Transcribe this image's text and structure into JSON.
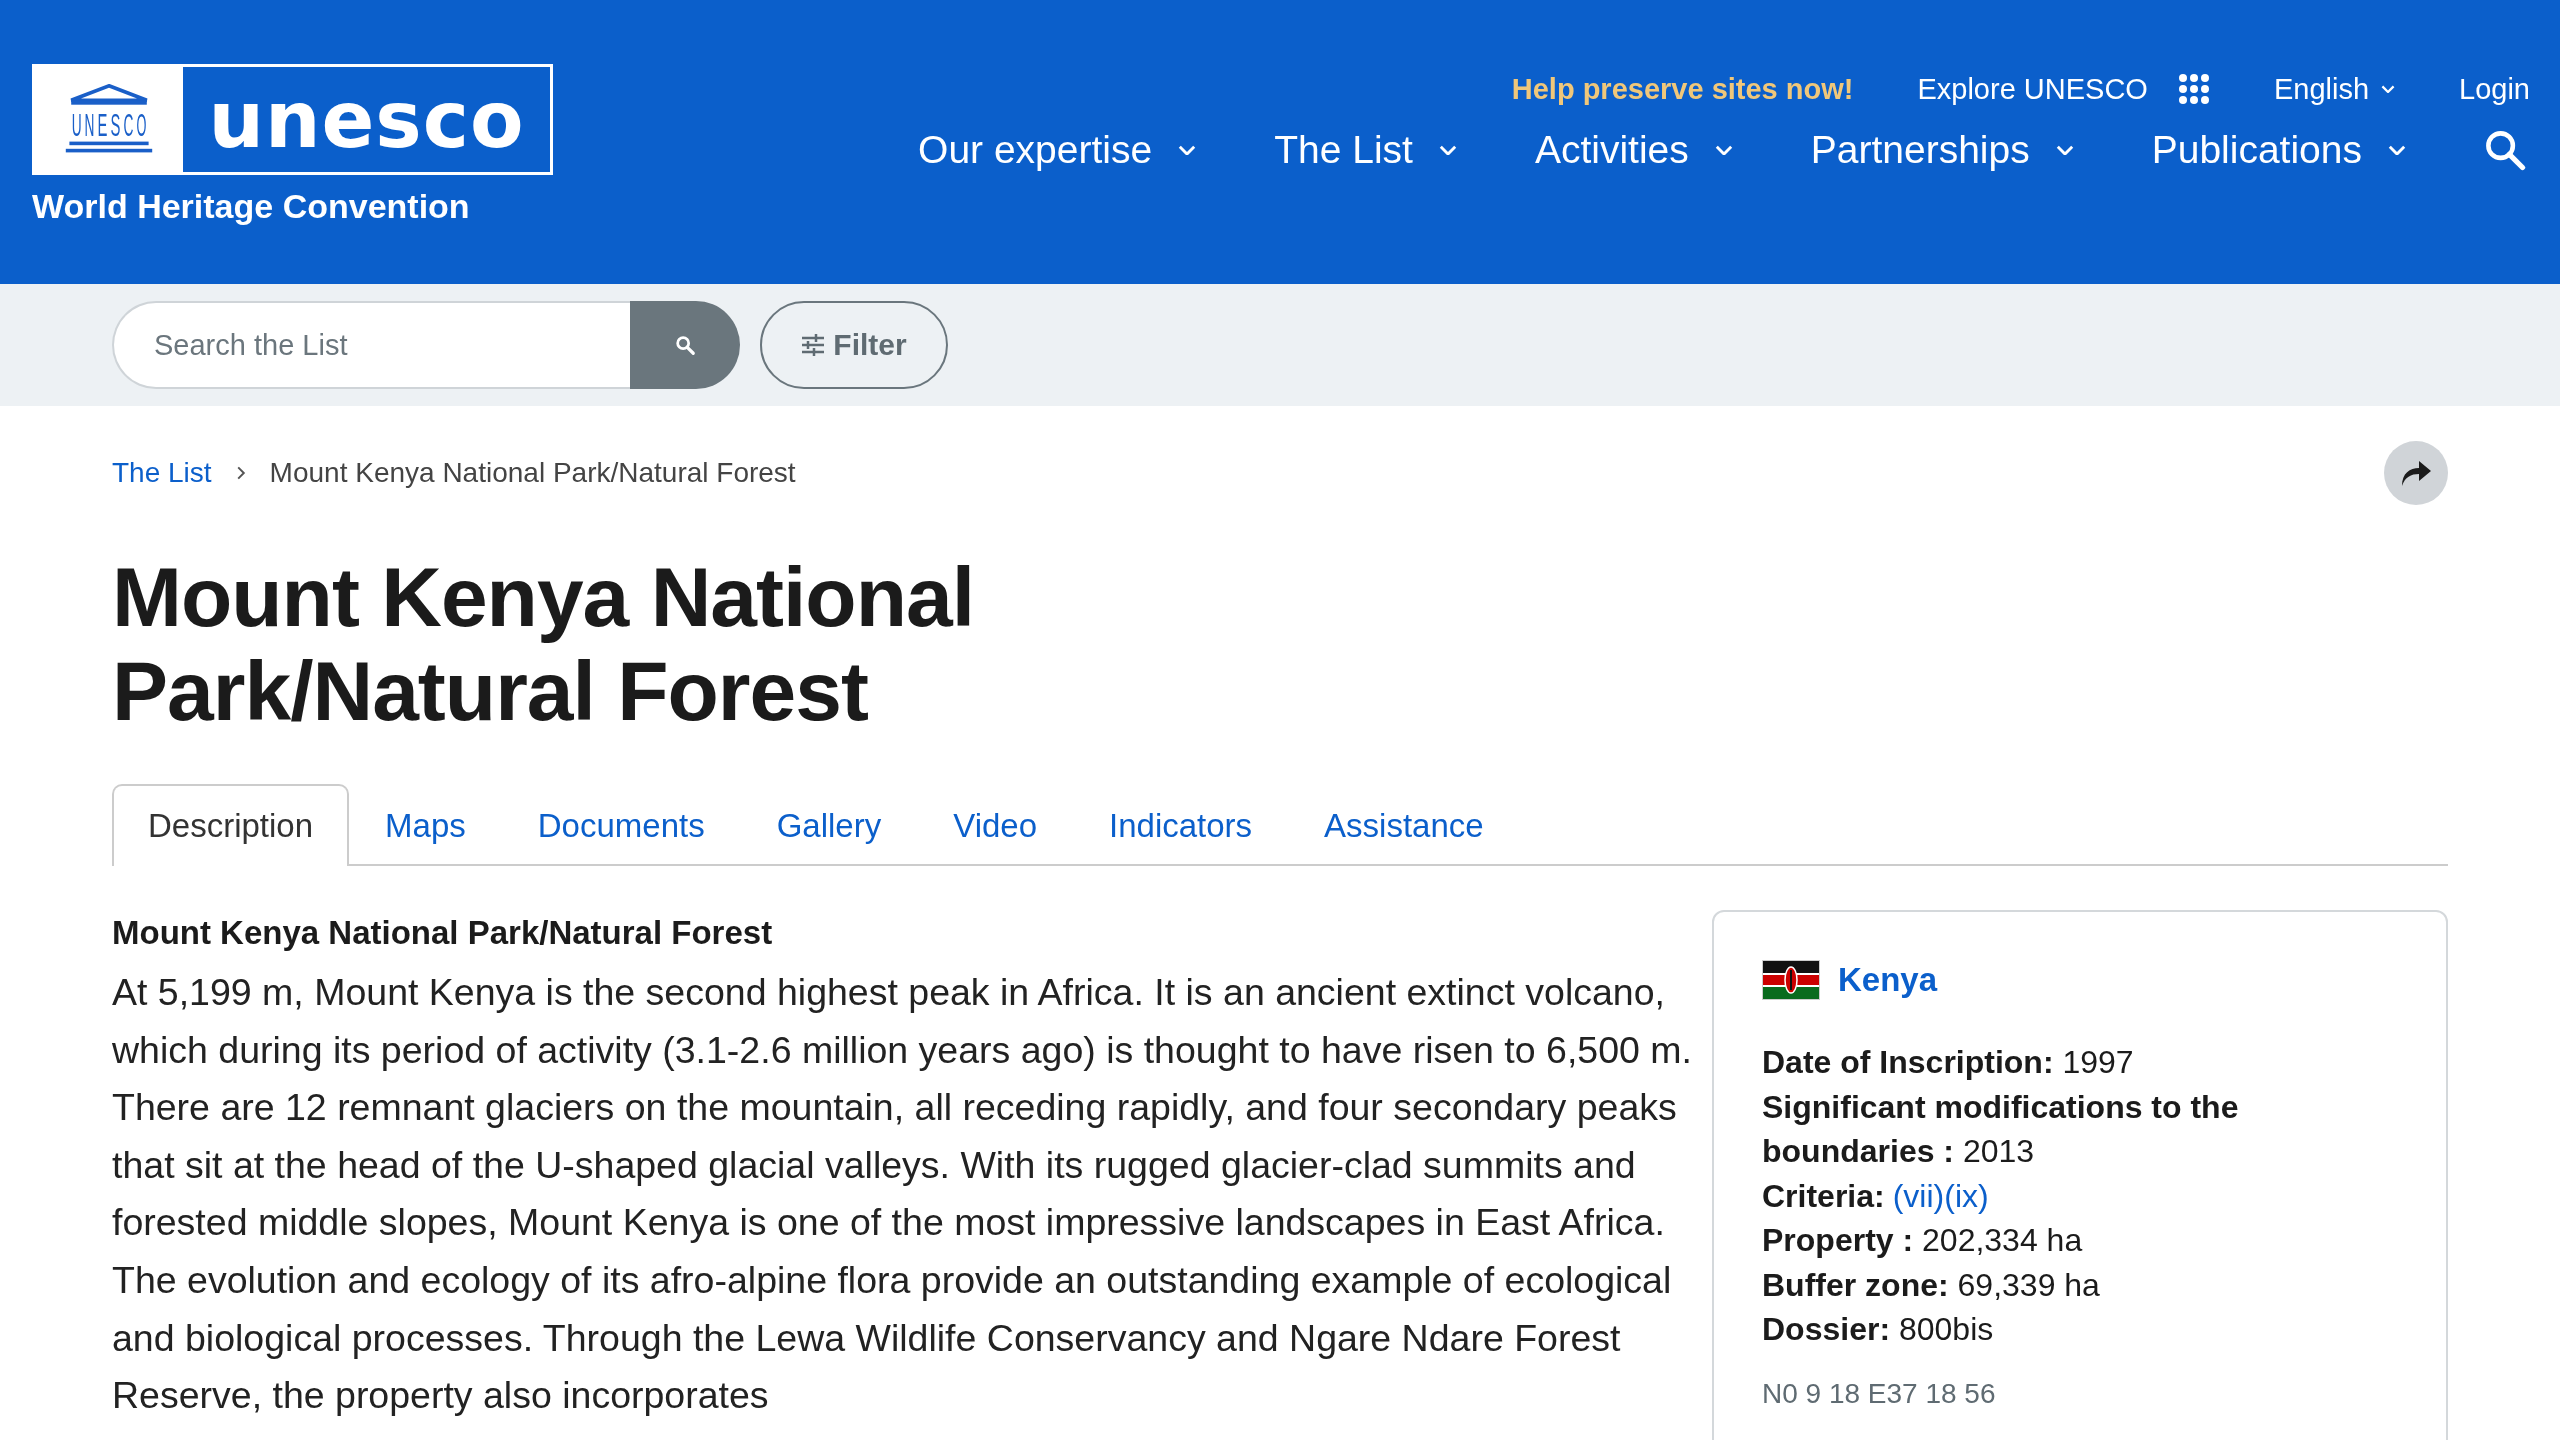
{
  "header": {
    "logo_word": "unesco",
    "logo_emblem_text": "UNESCO",
    "subtitle": "World Heritage Convention",
    "top_links": [
      {
        "kind": "highlight",
        "label": "Help preserve sites now!"
      },
      {
        "kind": "apps",
        "label": "Explore UNESCO"
      },
      {
        "kind": "dropdown",
        "label": "English"
      },
      {
        "kind": "plain",
        "label": "Login"
      }
    ],
    "nav": [
      {
        "label": "Our expertise"
      },
      {
        "label": "The List"
      },
      {
        "label": "Activities"
      },
      {
        "label": "Partnerships"
      },
      {
        "label": "Publications"
      }
    ]
  },
  "search": {
    "placeholder": "Search the List",
    "filter_label": "Filter"
  },
  "breadcrumb": [
    {
      "label": "The List",
      "link": true
    },
    {
      "label": "Mount Kenya National Park/Natural Forest",
      "link": false
    }
  ],
  "title": "Mount Kenya National Park/Natural Forest",
  "tabs": [
    {
      "label": "Description",
      "selected": true
    },
    {
      "label": "Maps",
      "selected": false
    },
    {
      "label": "Documents",
      "selected": false
    },
    {
      "label": "Gallery",
      "selected": false
    },
    {
      "label": "Video",
      "selected": false
    },
    {
      "label": "Indicators",
      "selected": false
    },
    {
      "label": "Assistance",
      "selected": false
    }
  ],
  "description": {
    "heading": "Mount Kenya National Park/Natural Forest",
    "text": "At 5,199 m, Mount Kenya is the second highest peak in Africa. It is an ancient extinct volcano, which during its period of activity (3.1-2.6 million years ago) is thought to have risen to 6,500 m. There are 12 remnant glaciers on the mountain, all receding rapidly, and four secondary peaks that sit at the head of the U-shaped glacial valleys. With its rugged glacier-clad summits and forested middle slopes, Mount Kenya is one of the most impressive landscapes in East Africa. The evolution and ecology of its afro-alpine flora provide an outstanding example of ecological and biological processes. Through the Lewa Wildlife Conservancy and Ngare Ndare Forest Reserve, the property also incorporates"
  },
  "info_card": {
    "country": "Kenya",
    "facts": [
      {
        "kind": "text",
        "label": "Date of Inscription:",
        "value": "1997"
      },
      {
        "kind": "text",
        "label": "Significant modifications to the boundaries :",
        "value": "2013"
      },
      {
        "kind": "links",
        "label": "Criteria:",
        "links": [
          "(vii)",
          "(ix)"
        ]
      },
      {
        "kind": "text",
        "label": "Property :",
        "value": "202,334 ha"
      },
      {
        "kind": "text",
        "label": "Buffer zone:",
        "value": "69,339 ha"
      },
      {
        "kind": "text",
        "label": "Dossier:",
        "value": "800bis"
      }
    ],
    "coordinates": "N0 9 18 E37 18 56"
  }
}
